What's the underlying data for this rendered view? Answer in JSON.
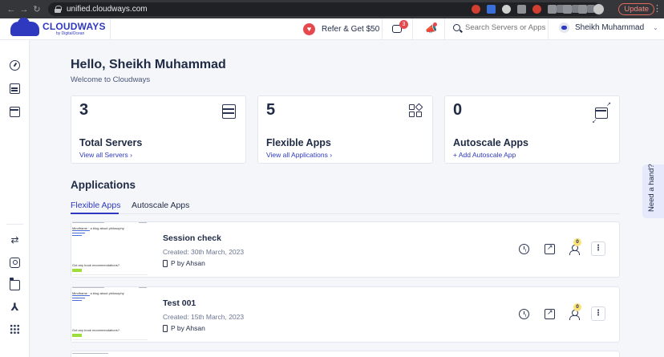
{
  "browser": {
    "url": "unified.cloudways.com",
    "update_label": "Update"
  },
  "topbar": {
    "logo_word": "CLOUDWAYS",
    "logo_sub": "by DigitalOcean",
    "refer_label": "Refer & Get $50",
    "bot_badge": "3",
    "search_placeholder": "Search Servers or Apps",
    "user_name": "Sheikh Muhammad"
  },
  "greeting": {
    "title": "Hello, Sheikh Muhammad",
    "subtitle": "Welcome to Cloudways"
  },
  "cards": [
    {
      "count": "3",
      "title": "Total Servers",
      "link": "View all Servers ›"
    },
    {
      "count": "5",
      "title": "Flexible Apps",
      "link": "View all Applications ›"
    },
    {
      "count": "0",
      "title": "Autoscale Apps",
      "link": "+ Add Autoscale App"
    }
  ],
  "applications": {
    "heading": "Applications",
    "tabs": [
      "Flexible Apps",
      "Autoscale Apps"
    ],
    "active_tab": "Flexible Apps",
    "rows": [
      {
        "name": "Session check",
        "created": "Created: 30th March, 2023",
        "owner": "P by Ahsan",
        "badge": "0"
      },
      {
        "name": "Test 001",
        "created": "Created: 15th March, 2023",
        "owner": "P by Ahsan",
        "badge": "0"
      }
    ]
  },
  "help_label": "Need a hand?",
  "colors": {
    "accent": "#2f39bf",
    "heart": "#e5484d",
    "badge": "#fbe27a"
  }
}
